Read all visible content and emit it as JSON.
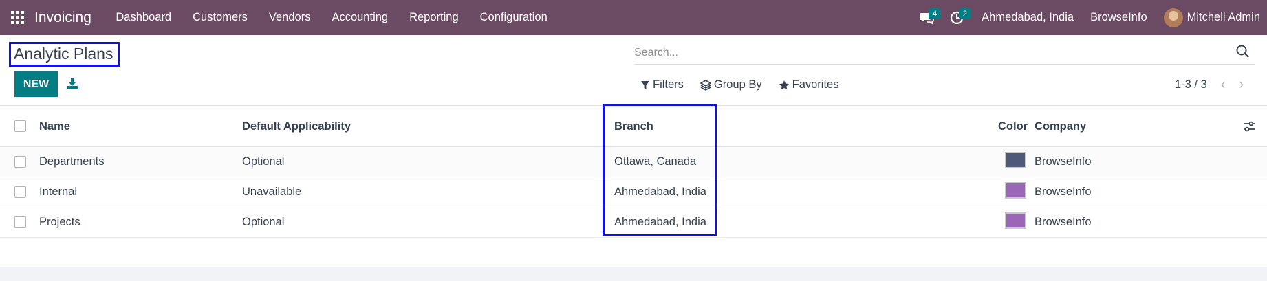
{
  "navbar": {
    "app_name": "Invoicing",
    "menu": [
      "Dashboard",
      "Customers",
      "Vendors",
      "Accounting",
      "Reporting",
      "Configuration"
    ],
    "messages_count": "4",
    "activities_count": "2",
    "branch": "Ahmedabad, India",
    "company": "BrowseInfo",
    "user": "Mitchell Admin"
  },
  "control": {
    "title": "Analytic Plans",
    "new_label": "NEW",
    "search_placeholder": "Search...",
    "filters_label": "Filters",
    "group_by_label": "Group By",
    "favorites_label": "Favorites",
    "pager": "1-3 / 3"
  },
  "table": {
    "columns": [
      "Name",
      "Default Applicability",
      "Branch",
      "Color",
      "Company"
    ],
    "rows": [
      {
        "name": "Departments",
        "applicability": "Optional",
        "branch": "Ottawa, Canada",
        "color": "#4f5a7a",
        "company": "BrowseInfo"
      },
      {
        "name": "Internal",
        "applicability": "Unavailable",
        "branch": "Ahmedabad, India",
        "color": "#9b65b8",
        "company": "BrowseInfo"
      },
      {
        "name": "Projects",
        "applicability": "Optional",
        "branch": "Ahmedabad, India",
        "color": "#9b65b8",
        "company": "BrowseInfo"
      }
    ]
  },
  "colors": {
    "navbar": "#6b4a63",
    "primary": "#017e84",
    "highlight": "#1212e6"
  }
}
